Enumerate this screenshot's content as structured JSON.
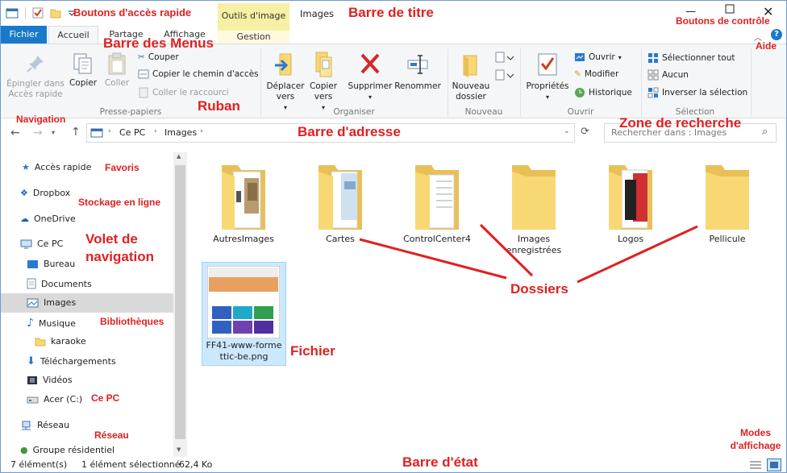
{
  "window": {
    "title": "Images",
    "context_tab": "Outils d'image",
    "context_subtab": "Gestion"
  },
  "tabs": [
    "Fichier",
    "Accueil",
    "Partage",
    "Affichage"
  ],
  "ribbon": {
    "pin": "Épingler dans Accès rapide",
    "copy": "Copier",
    "paste": "Coller",
    "cut": "Couper",
    "copy_path": "Copier le chemin d'accès",
    "paste_shortcut": "Coller le raccourci",
    "group_clipboard": "Presse-papiers",
    "move_to": "Déplacer vers",
    "copy_to": "Copier vers",
    "delete": "Supprimer",
    "rename": "Renommer",
    "group_organize": "Organiser",
    "new_folder": "Nouveau dossier",
    "group_new": "Nouveau",
    "properties": "Propriétés",
    "open": "Ouvrir",
    "edit": "Modifier",
    "history": "Historique",
    "group_open": "Ouvrir",
    "select_all": "Sélectionner tout",
    "select_none": "Aucun",
    "invert_selection": "Inverser la sélection",
    "group_select": "Sélection"
  },
  "address": {
    "crumbs": [
      "Ce PC",
      "Images"
    ],
    "search_placeholder": "Rechercher dans : Images"
  },
  "nav_pane": {
    "items": [
      "Accès rapide",
      "Dropbox",
      "OneDrive",
      "Ce PC",
      "Bureau",
      "Documents",
      "Images",
      "Musique",
      "karaoke",
      "Téléchargements",
      "Vidéos",
      "Acer (C:)",
      "Réseau",
      "Groupe résidentiel"
    ]
  },
  "folders": [
    "AutresImages",
    "Cartes",
    "ControlCenter4",
    "Images enregistrées",
    "Logos",
    "Pellicule"
  ],
  "file": {
    "name": "FF41-www-formettic-be.png"
  },
  "status": {
    "count": "7 élément(s)",
    "selected": "1 élément sélectionné",
    "size": "62,4 Ko"
  },
  "annotations": {
    "qat": "Boutons d'accès rapide",
    "title_bar": "Barre de titre",
    "control_buttons": "Boutons de contrôle",
    "menus": "Barre des Menus",
    "help": "Aide",
    "ribbon": "Ruban",
    "navigation": "Navigation",
    "address_bar": "Barre d'adresse",
    "search_zone": "Zone de recherche",
    "favorites": "Favoris",
    "cloud": "Stockage en ligne",
    "nav_pane": "Volet de navigation",
    "libraries": "Bibliothèques",
    "this_pc": "Ce PC",
    "network": "Réseau",
    "folders": "Dossiers",
    "file": "Fichier",
    "display_modes": "Modes d'affichage",
    "status_bar": "Barre d'état"
  },
  "colors": {
    "accent": "#1979ca",
    "annotation": "#e02020",
    "folder": "#f8d775",
    "selection": "#cce8ff"
  }
}
